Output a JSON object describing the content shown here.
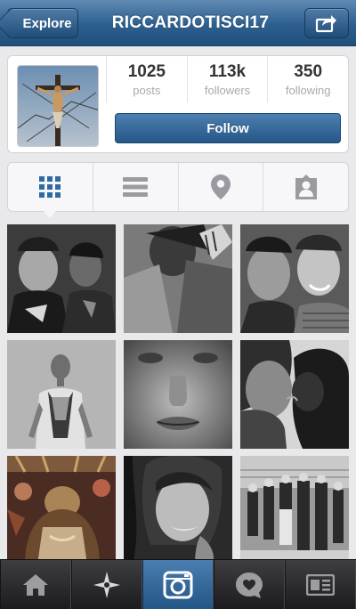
{
  "navbar": {
    "back_label": "Explore",
    "title": "RICCARDOTISCI17",
    "share_icon": "share-icon"
  },
  "profile": {
    "avatar_icon": "crucifix-photo",
    "stats": [
      {
        "value": "1025",
        "label": "posts"
      },
      {
        "value": "113k",
        "label": "followers"
      },
      {
        "value": "350",
        "label": "following"
      }
    ],
    "follow_label": "Follow"
  },
  "view_tabs": [
    {
      "icon": "grid-icon",
      "active": true
    },
    {
      "icon": "list-icon",
      "active": false
    },
    {
      "icon": "location-pin-icon",
      "active": false
    },
    {
      "icon": "tagged-person-icon",
      "active": false
    }
  ],
  "photos": [
    {
      "icon": "photo"
    },
    {
      "icon": "photo"
    },
    {
      "icon": "photo"
    },
    {
      "icon": "photo"
    },
    {
      "icon": "photo"
    },
    {
      "icon": "photo"
    },
    {
      "icon": "photo"
    },
    {
      "icon": "photo"
    },
    {
      "icon": "photo"
    }
  ],
  "tabbar": [
    {
      "icon": "home-icon"
    },
    {
      "icon": "explore-star-icon"
    },
    {
      "icon": "camera-icon",
      "active": true
    },
    {
      "icon": "activity-heart-bubble-icon"
    },
    {
      "icon": "profile-card-icon"
    }
  ],
  "colors": {
    "navbar_blue": "#2d5f8e",
    "follow_blue": "#245788",
    "accent_grid_blue": "#2f6aa5",
    "page_bg": "#e9e9ec",
    "tabbar_dark": "#1c1c1f"
  }
}
